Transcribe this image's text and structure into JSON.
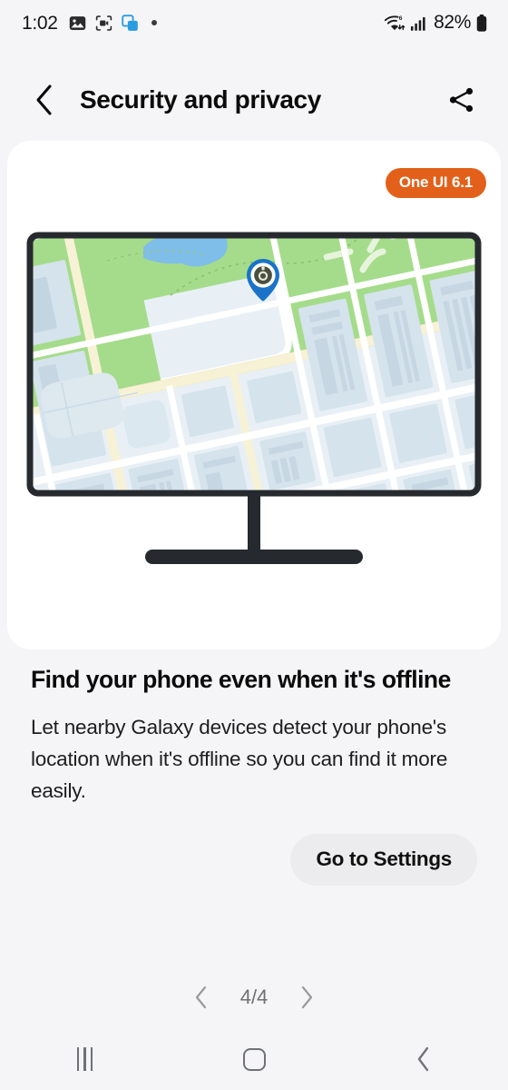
{
  "statusbar": {
    "time": "1:02",
    "left_icons": [
      "image-icon",
      "screen-record-icon",
      "multi-window-icon",
      "dot-indicator"
    ],
    "battery_percent": "82%",
    "right_icons": [
      "wifi6-icon",
      "signal-bars-icon",
      "battery-icon"
    ]
  },
  "header": {
    "back_icon": "chevron-left-icon",
    "title": "Security and privacy",
    "share_icon": "share-icon"
  },
  "card": {
    "badge": "One UI 6.1",
    "illustration": "monitor-showing-map-with-location-pin"
  },
  "feature": {
    "title": "Find your phone even when it's offline",
    "description": "Let nearby Galaxy devices detect your phone's location when it's offline so you can find it more easily."
  },
  "action": {
    "go_to_settings_label": "Go to Settings"
  },
  "pagination": {
    "prev_icon": "chevron-left-icon",
    "counter": "4/4",
    "next_icon": "chevron-right-icon"
  },
  "navbar": {
    "recents_icon": "recents-icon",
    "home_icon": "home-icon",
    "back_icon": "back-icon"
  },
  "colors": {
    "page_background": "#F5F5F7",
    "card_background": "#FFFFFF",
    "badge_orange": "#E2601A",
    "button_gray": "#ECECEE",
    "map_park_green": "#A5DC8B",
    "map_water_blue": "#7FBEE8",
    "map_road_cream": "#F7F2D6",
    "map_building_blue": "#D5E3EC",
    "map_base": "#E8F0F6",
    "pin_blue": "#1A73C8",
    "monitor_frame": "#262A2E"
  }
}
